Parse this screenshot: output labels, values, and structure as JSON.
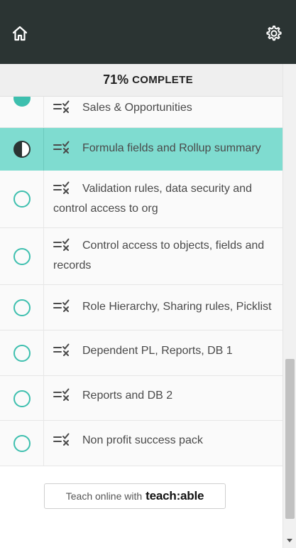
{
  "progress": {
    "percent": "71%",
    "label": "COMPLETE",
    "value": 71
  },
  "lectures": [
    {
      "title": "Sales & Opportunities",
      "status": "complete"
    },
    {
      "title": "Formula fields and Rollup summary",
      "status": "in-progress"
    },
    {
      "title": "Validation rules, data security and control access to org",
      "status": "not-started"
    },
    {
      "title": "Control access to objects, fields and records",
      "status": "not-started"
    },
    {
      "title": "Role Hierarchy, Sharing rules, Picklist",
      "status": "not-started"
    },
    {
      "title": "Dependent PL, Reports, DB 1",
      "status": "not-started"
    },
    {
      "title": "Reports and DB 2",
      "status": "not-started"
    },
    {
      "title": "Non profit success pack",
      "status": "not-started"
    }
  ],
  "footer": {
    "teach_prefix": "Teach online with",
    "teach_brand": "teach:able"
  },
  "icons": {
    "home": "home-icon",
    "settings": "gear-icon",
    "lecture_type": "quiz-icon"
  },
  "colors": {
    "header": "#2b3433",
    "accent": "#3dbfae",
    "active_row": "#7fdcd0"
  }
}
